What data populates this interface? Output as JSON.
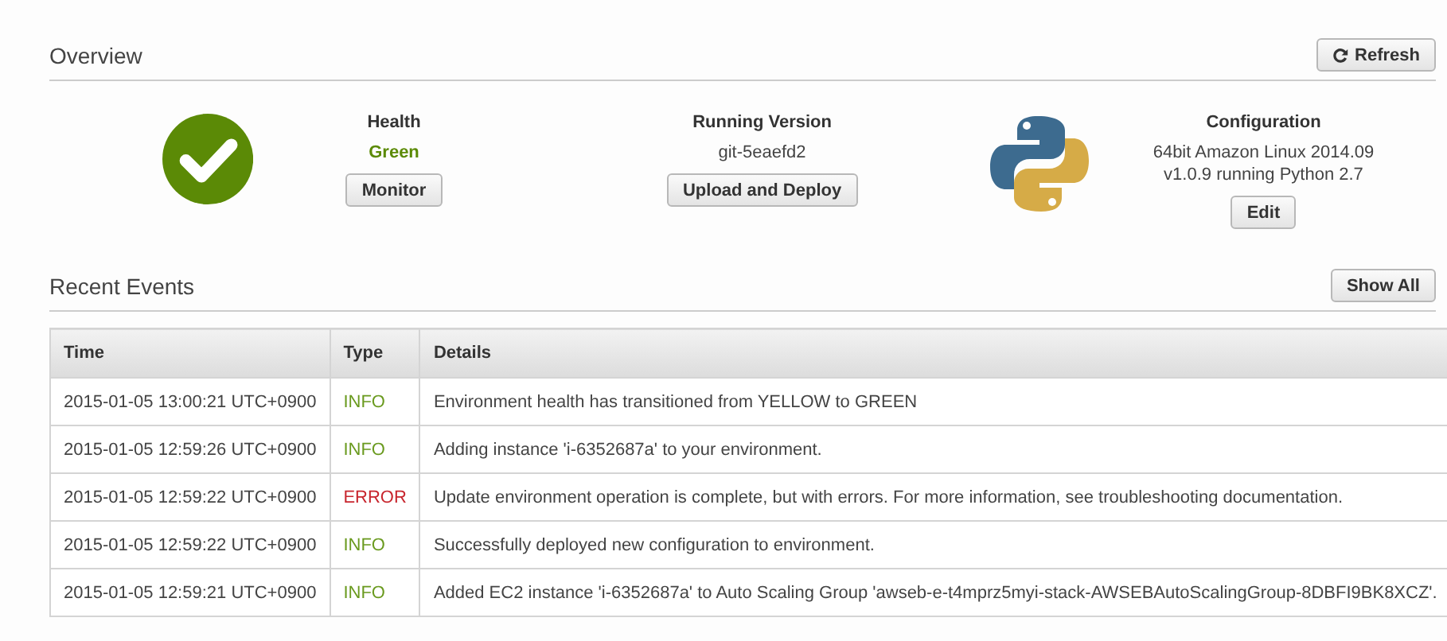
{
  "overview": {
    "title": "Overview",
    "refresh_button": "Refresh",
    "health": {
      "label": "Health",
      "value": "Green",
      "button": "Monitor"
    },
    "running_version": {
      "label": "Running Version",
      "value": "git-5eaefd2",
      "button": "Upload and Deploy"
    },
    "configuration": {
      "label": "Configuration",
      "lines": [
        "64bit Amazon Linux 2014.09",
        "v1.0.9 running Python 2.7"
      ],
      "button": "Edit"
    }
  },
  "recent_events": {
    "title": "Recent Events",
    "show_all_button": "Show All",
    "columns": [
      "Time",
      "Type",
      "Details"
    ],
    "rows": [
      {
        "time": "2015-01-05 13:00:21 UTC+0900",
        "type": "INFO",
        "color": "#6a9a1f",
        "details": "Environment health has transitioned from YELLOW to GREEN"
      },
      {
        "time": "2015-01-05 12:59:26 UTC+0900",
        "type": "INFO",
        "color": "#6a9a1f",
        "details": "Adding instance 'i-6352687a' to your environment."
      },
      {
        "time": "2015-01-05 12:59:22 UTC+0900",
        "type": "ERROR",
        "color": "#c8262e",
        "details": "Update environment operation is complete, but with errors. For more information, see troubleshooting documentation."
      },
      {
        "time": "2015-01-05 12:59:22 UTC+0900",
        "type": "INFO",
        "color": "#6a9a1f",
        "details": "Successfully deployed new configuration to environment."
      },
      {
        "time": "2015-01-05 12:59:21 UTC+0900",
        "type": "INFO",
        "color": "#6a9a1f",
        "details": "Added EC2 instance 'i-6352687a' to Auto Scaling Group 'awseb-e-t4mprz5myi-stack-AWSEBAutoScalingGroup-8DBFI9BK8XCZ'."
      }
    ]
  }
}
